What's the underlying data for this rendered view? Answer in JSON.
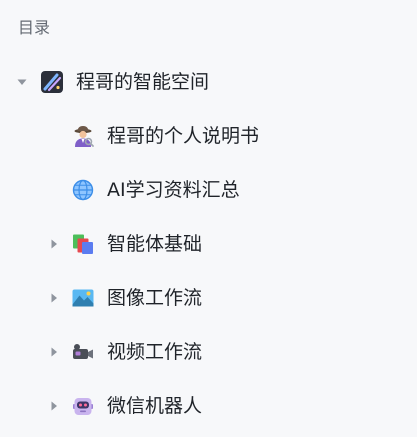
{
  "toc": {
    "heading": "目录"
  },
  "tree": {
    "root": {
      "label": "程哥的智能空间",
      "icon": "space-icon",
      "expanded": true
    },
    "children": [
      {
        "label": "程哥的个人说明书",
        "icon": "detective-icon",
        "has_children": false
      },
      {
        "label": "AI学习资料汇总",
        "icon": "globe-icon",
        "has_children": false
      },
      {
        "label": "智能体基础",
        "icon": "books-icon",
        "has_children": true
      },
      {
        "label": "图像工作流",
        "icon": "picture-icon",
        "has_children": true
      },
      {
        "label": "视频工作流",
        "icon": "video-camera-icon",
        "has_children": true
      },
      {
        "label": "微信机器人",
        "icon": "robot-icon",
        "has_children": true
      }
    ]
  },
  "colors": {
    "background": "#f7f8fa",
    "heading_text": "#646a73",
    "item_text": "#1f2329",
    "arrow": "#8f959e"
  }
}
